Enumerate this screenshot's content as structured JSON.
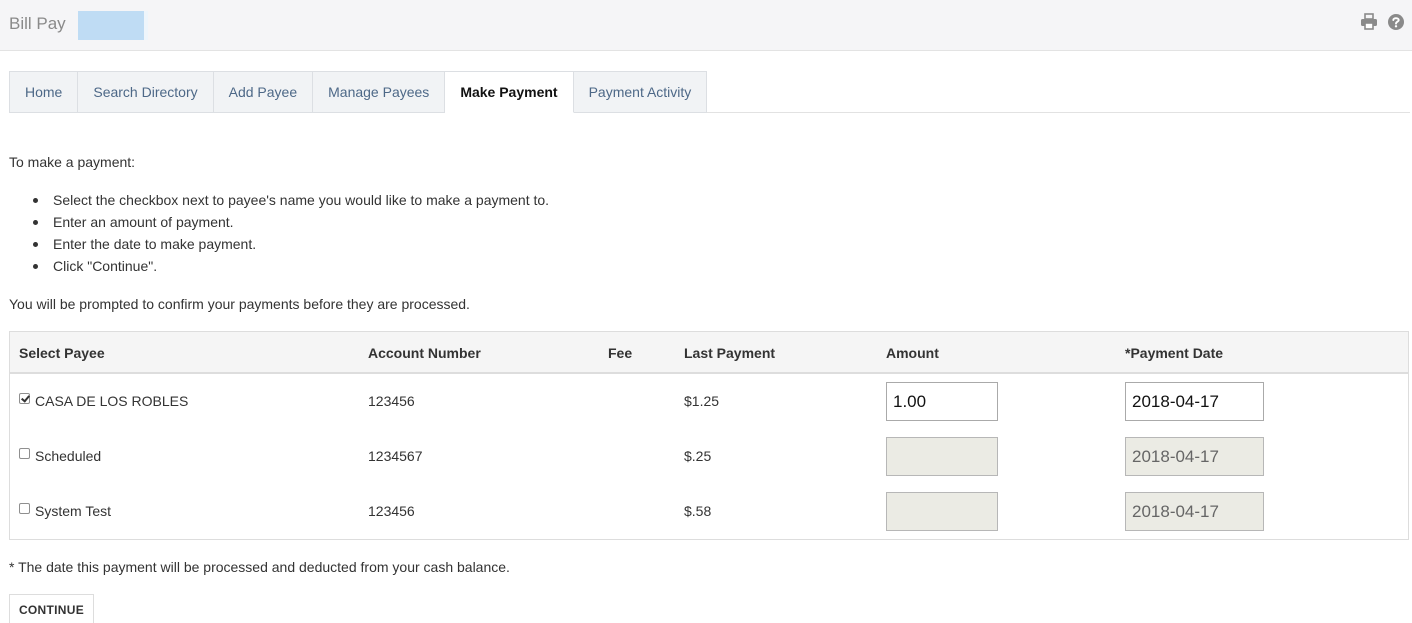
{
  "header": {
    "title": "Bill Pay",
    "icons": {
      "print": "print-icon",
      "help": "help-icon"
    }
  },
  "tabs": [
    {
      "label": "Home",
      "active": false
    },
    {
      "label": "Search Directory",
      "active": false
    },
    {
      "label": "Add Payee",
      "active": false
    },
    {
      "label": "Manage Payees",
      "active": false
    },
    {
      "label": "Make Payment",
      "active": true
    },
    {
      "label": "Payment Activity",
      "active": false
    }
  ],
  "instructions": {
    "intro": "To make a payment:",
    "steps": [
      "Select the checkbox next to payee's name you would like to make a payment to.",
      "Enter an amount of payment.",
      "Enter the date to make payment.",
      "Click \"Continue\"."
    ],
    "prompt": "You will be prompted to confirm your payments before they are processed."
  },
  "table": {
    "headers": {
      "payee": "Select Payee",
      "account": "Account Number",
      "fee": "Fee",
      "last_payment": "Last Payment",
      "amount": "Amount",
      "date": "*Payment Date"
    },
    "rows": [
      {
        "checked": true,
        "payee": "CASA DE LOS ROBLES",
        "account": "123456",
        "fee": "",
        "last_payment": "$1.25",
        "amount": "1.00",
        "date": "2018-04-17",
        "disabled": false
      },
      {
        "checked": false,
        "payee": "Scheduled",
        "account": "1234567",
        "fee": "",
        "last_payment": "$.25",
        "amount": "",
        "date": "2018-04-17",
        "disabled": true
      },
      {
        "checked": false,
        "payee": "System Test",
        "account": "123456",
        "fee": "",
        "last_payment": "$.58",
        "amount": "",
        "date": "2018-04-17",
        "disabled": true
      }
    ]
  },
  "footnote": "* The date this payment will be processed and deducted from your cash balance.",
  "continue_label": "CONTINUE",
  "colors": {
    "tab_text": "#4d6887",
    "header_bg": "#f5f5f7",
    "disabled_input": "#ebebe4"
  }
}
